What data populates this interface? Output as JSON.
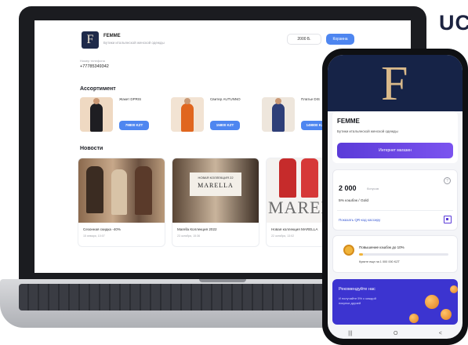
{
  "brand_mark": "UC",
  "desktop": {
    "header": {
      "logo_letter": "F",
      "title": "FEMME",
      "subtitle": "Бутики итальянской женской одежды",
      "balance": "2000 Б.",
      "cart_label": "Корзина"
    },
    "phone_label": "Номер телефона",
    "phone_value": "+77785349342",
    "assortment_title": "Ассортимент",
    "products": [
      {
        "name": "Жакет DPRIS",
        "price": "79800 KZT"
      },
      {
        "name": "Свитер AUTUNNO",
        "price": "15800 KZT"
      },
      {
        "name": "Платье DIS",
        "price": "149800 KZT"
      }
    ],
    "news_title": "Новости",
    "news": [
      {
        "caption": "Сезонная скидка -40%",
        "date": "15 января, 10:07"
      },
      {
        "caption": "Marella Коллекция 2022",
        "date": "23 октября, 15:36",
        "overlay_small": "НОВАЯ КОЛЛЕКЦИЯ 22",
        "overlay_big": "MARELLA"
      },
      {
        "caption": "Новая коллекция MARELLA",
        "date": "22 октября, 13:02",
        "overlay_big": "MAREL"
      }
    ]
  },
  "phone": {
    "hero_letter": "F",
    "title": "FEMME",
    "subtitle": "Бутики итальянской женской одежды",
    "shop_button": "Интернет магазин",
    "balance_value": "2 000",
    "balance_unit": "бонусов",
    "help_glyph": "?",
    "cashback": "5% кэшбэк / Gold",
    "qr_link": "Показать QR-код кассиру",
    "level_title": "Повышение кэшбэк до 10%",
    "level_note": "Купите еще на 1 000 000 KZT",
    "level_progress": 0.04,
    "promo_title": "Рекомендуйте нас",
    "promo_text": "И получайте 5% с каждой покупки друзей",
    "nav": [
      "|||",
      "O",
      "<"
    ]
  }
}
